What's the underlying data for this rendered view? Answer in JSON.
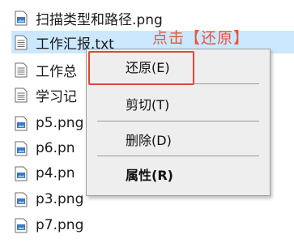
{
  "files": [
    {
      "name": "扫描类型和路径.png",
      "icon": "image-file-icon"
    },
    {
      "name": "工作汇报.txt",
      "icon": "text-file-icon",
      "selected": true
    },
    {
      "name": "工作总",
      "icon": "text-file-icon"
    },
    {
      "name": "学习记",
      "icon": "text-file-icon"
    },
    {
      "name": "p5.png",
      "icon": "image-file-icon"
    },
    {
      "name": "p6.pn",
      "icon": "image-file-icon"
    },
    {
      "name": "p4.pn",
      "icon": "image-file-icon"
    },
    {
      "name": "p3.png",
      "icon": "image-file-icon"
    },
    {
      "name": "p7.png",
      "icon": "image-file-icon"
    }
  ],
  "annotation": "点击【还原】",
  "context_menu": {
    "items": [
      {
        "label": "还原(E)",
        "bold": false
      },
      {
        "label": "剪切(T)",
        "bold": false
      },
      {
        "label": "删除(D)",
        "bold": false
      },
      {
        "label": "属性(R)",
        "bold": true
      }
    ]
  },
  "colors": {
    "selection": "#cce8ff",
    "annotation": "#e8553a",
    "highlight_border": "#e0473a",
    "menu_bg": "#eeeeee"
  }
}
